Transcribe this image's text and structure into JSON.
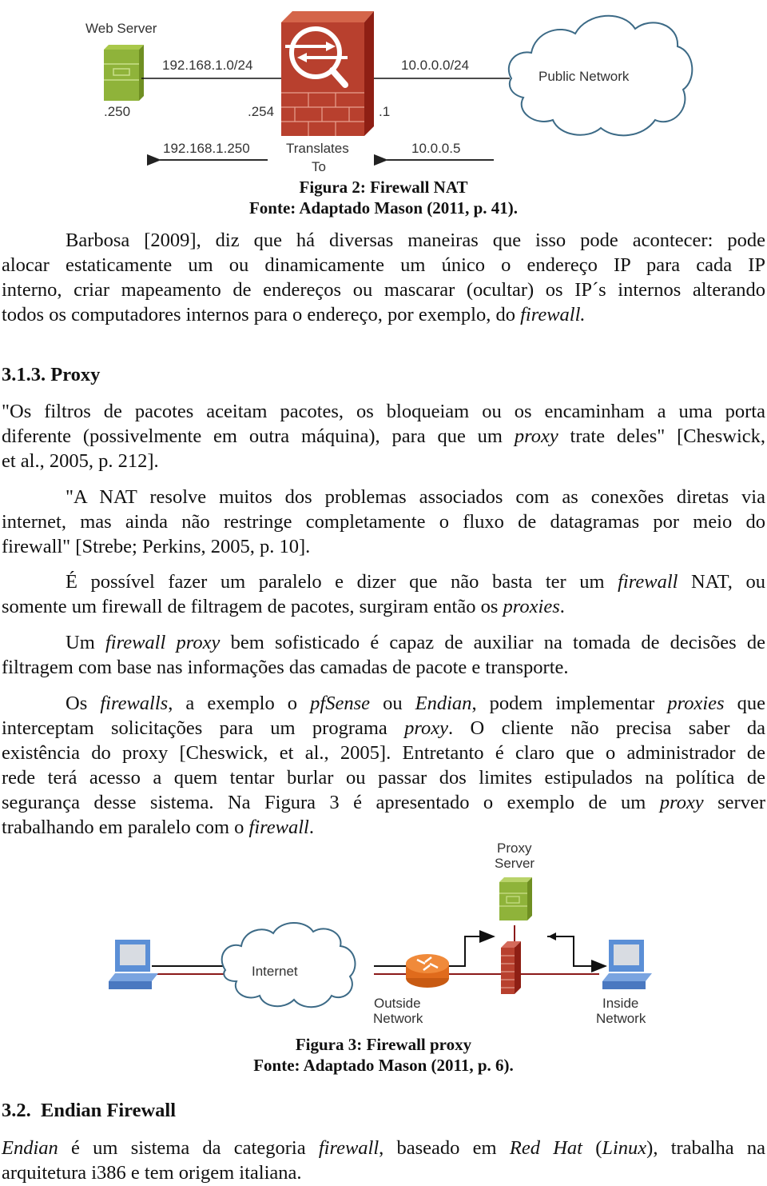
{
  "figure2": {
    "labels": {
      "web_server": "Web Server",
      "lan_subnet": "192.168.1.0/24",
      "wan_subnet": "10.0.0.0/24",
      "public_network": "Public Network",
      "server_host": ".250",
      "fw_inside": ".254",
      "fw_outside": ".1",
      "inside_ip": "192.168.1.250",
      "translates_1": "Translates",
      "translates_2": "To",
      "outside_ip": "10.0.0.5"
    },
    "caption": "Figura 2: Firewall NAT",
    "source": "Fonte: Adaptado Mason (2011, p. 41)."
  },
  "para1": {
    "lines": [
      "Barbosa [2009], diz que há diversas maneiras que isso pode acontecer: pode",
      "alocar estaticamente um ou dinamicamente um único o endereço IP para cada IP",
      "interno, criar mapeamento de endereços ou mascarar (ocultar) os IP´s internos alterando"
    ],
    "last_line_prefix": "todos os computadores internos para o endereço, por exemplo, do ",
    "last_line_italic": "firewall."
  },
  "section_313": {
    "heading": "3.1.3. Proxy"
  },
  "quote1": {
    "line1": "\"Os filtros de pacotes aceitam pacotes, os bloqueiam ou os encaminham a uma porta",
    "line2_a": "diferente (possivelmente em outra máquina), para que um ",
    "line2_i": "proxy",
    "line2_b": " trate deles\" [Cheswick,",
    "line3": "et al., 2005, p. 212]."
  },
  "quote2": {
    "lines": [
      "\"A NAT resolve muitos dos problemas associados com as conexões diretas via",
      "internet, mas ainda não restringe completamente o fluxo de datagramas por meio do",
      "firewall\" [Strebe; Perkins, 2005, p. 10]."
    ]
  },
  "para2": {
    "l1_a": "É possível fazer um paralelo e dizer que não basta ter um ",
    "l1_i": "firewall",
    "l1_b": " NAT, ou",
    "l2_a": "somente um firewall de filtragem de pacotes, surgiram então os ",
    "l2_i": "proxies",
    "l2_b": "."
  },
  "para3": {
    "l1_a": "Um ",
    "l1_i": "firewall proxy",
    "l1_b": " bem sofisticado é capaz de auxiliar na tomada de decisões de",
    "l2": "filtragem com base nas informações das camadas de pacote e transporte."
  },
  "para4": {
    "l1_a": "Os ",
    "l1_i1": "firewalls",
    "l1_b": ", a exemplo o ",
    "l1_i2": "pfSense",
    "l1_c": " ou ",
    "l1_i3": "Endian",
    "l1_d": ", podem implementar ",
    "l1_i4": "proxies",
    "l1_e": " que",
    "l2_a": "interceptam solicitações para um programa ",
    "l2_i": "proxy",
    "l2_b": ". O cliente não precisa saber da",
    "l3": "existência do proxy [Cheswick, et al., 2005]. Entretanto é claro que o administrador de",
    "l4": "rede terá acesso a quem tentar burlar ou passar dos limites estipulados na política de",
    "l5_a": "segurança desse sistema. Na Figura 3 é apresentado o exemplo de um ",
    "l5_i": "proxy",
    "l5_b": " server",
    "l6_a": "trabalhando em paralelo com o ",
    "l6_i": "firewall",
    "l6_b": "."
  },
  "figure3": {
    "labels": {
      "proxy_1": "Proxy",
      "proxy_2": "Server",
      "internet": "Internet",
      "outside_1": "Outside",
      "outside_2": "Network",
      "inside_1": "Inside",
      "inside_2": "Network"
    },
    "caption": "Figura 3: Firewall proxy",
    "source": "Fonte: Adaptado Mason (2011, p. 6)."
  },
  "section_32": {
    "heading": "3.2.  Endian Firewall"
  },
  "para5": {
    "l1_i1": "Endian",
    "l1_a": " é um sistema da categoria ",
    "l1_i2": "firewall",
    "l1_b": ", baseado em ",
    "l1_i3": "Red Hat",
    "l1_c": " (",
    "l1_i4": "Linux",
    "l1_d": "), trabalha na",
    "l2": "arquitetura i386 e tem origem italiana."
  }
}
